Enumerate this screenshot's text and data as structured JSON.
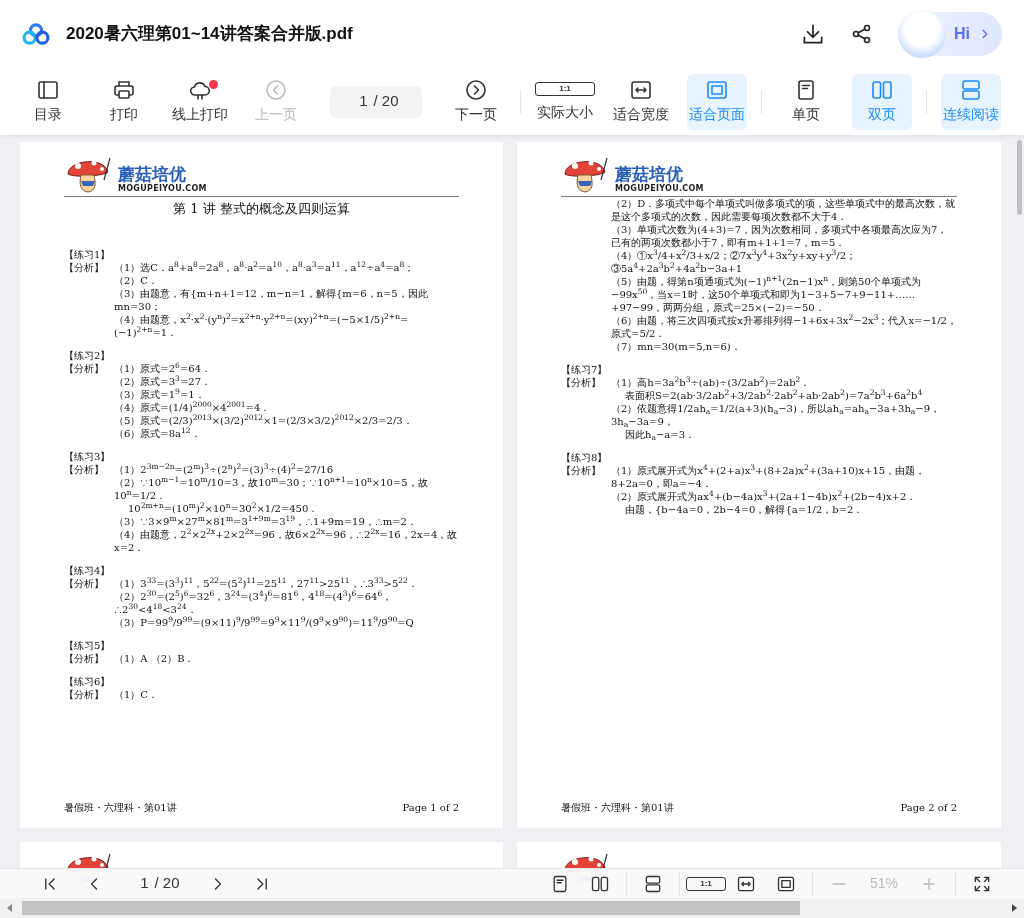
{
  "header": {
    "title": "2020暑六理第01~14讲答案合并版.pdf",
    "greeting": "Hi"
  },
  "toolbar": {
    "items": [
      {
        "kind": "toc",
        "label": "目录",
        "selected": false,
        "disabled": false,
        "notify": false,
        "divider_after": false
      },
      {
        "kind": "print",
        "label": "打印",
        "selected": false,
        "disabled": false,
        "notify": false,
        "divider_after": false
      },
      {
        "kind": "cloud",
        "label": "线上打印",
        "selected": false,
        "disabled": false,
        "notify": true,
        "divider_after": false
      },
      {
        "kind": "prev",
        "label": "上一页",
        "selected": false,
        "disabled": true,
        "notify": false,
        "divider_after": false
      },
      {
        "kind": "pagefield",
        "value": "1",
        "total": "/ 20"
      },
      {
        "kind": "next",
        "label": "下一页",
        "selected": false,
        "disabled": false,
        "notify": false,
        "divider_after": true
      },
      {
        "kind": "actual",
        "label": "实际大小",
        "icon_text": "1:1",
        "selected": false,
        "disabled": false,
        "notify": false,
        "divider_after": false
      },
      {
        "kind": "fitwidth",
        "label": "适合宽度",
        "selected": false,
        "disabled": false,
        "notify": false,
        "divider_after": false
      },
      {
        "kind": "fitpage",
        "label": "适合页面",
        "selected": true,
        "disabled": false,
        "notify": false,
        "divider_after": true
      },
      {
        "kind": "single",
        "label": "单页",
        "selected": false,
        "disabled": false,
        "notify": false,
        "divider_after": false
      },
      {
        "kind": "double",
        "label": "双页",
        "selected": true,
        "disabled": false,
        "notify": false,
        "divider_after": true
      },
      {
        "kind": "continuous",
        "label": "连续阅读",
        "selected": true,
        "disabled": false,
        "notify": false,
        "divider_after": false
      }
    ]
  },
  "pages": [
    {
      "logo_text": "蘑菇培优",
      "logo_sub": "MOGUPEIYOU.COM",
      "title": "第 1 讲  整式的概念及四则运算",
      "blocks": [
        {
          "heading": "【练习1】",
          "label": "【分析】",
          "lines": [
            {
              "kind": "item",
              "text": "（1）选C．a$^{8}$+a$^{8}$=2a$^{8}$，a$^{8}$·a$^{2}$=a$^{10}$，a$^{8}$·a$^{3}$=a$^{11}$，a$^{12}$÷a$^{4}$=a$^{8}$；"
            },
            {
              "kind": "item",
              "text": "（2）C．"
            },
            {
              "kind": "item",
              "text": "（3）由题意，有{m+n+1=12，m−n=1，解得{m=6，n=5，因此mn=30；"
            },
            {
              "kind": "item",
              "text": "（4）由题意，x$^{2}$·x$^{2}$·(y$^{n}$)$^{2}$=x$^{2+n}$·y$^{2+n}$=(xy)$^{2+n}$=(−5×1/5)$^{2+n}$=(−1)$^{2+n}$=1．"
            }
          ]
        },
        {
          "heading": "【练习2】",
          "label": "【分析】",
          "lines": [
            {
              "kind": "item",
              "text": "（1）原式=2$^{6}$=64．"
            },
            {
              "kind": "item",
              "text": "（2）原式=3$^{3}$=27．"
            },
            {
              "kind": "item",
              "text": "（3）原式=1$^{9}$=1．"
            },
            {
              "kind": "item",
              "text": "（4）原式=(1/4)$^{2000}$×4$^{2001}$=4．"
            },
            {
              "kind": "item",
              "text": "（5）原式=(2/3)$^{2013}$×(3/2)$^{2012}$×1=(2/3×3/2)$^{2012}$×2/3=2/3．"
            },
            {
              "kind": "item",
              "text": "（6）原式=8a$^{12}$．"
            }
          ]
        },
        {
          "heading": "【练习3】",
          "label": "【分析】",
          "lines": [
            {
              "kind": "item",
              "text": "（1）2$^{3m−2n}$=(2$^{m}$)$^{3}$÷(2$^{n}$)$^{2}$=(3)$^{3}$÷(4)$^{2}$=27/16"
            },
            {
              "kind": "item",
              "text": "（2）∵10$^{m−1}$=10$^{m}$/10=3，故10$^{m}$=30；∵10$^{n+1}$=10$^{n}$×10=5，故10$^{n}$=1/2．"
            },
            {
              "kind": "continuation",
              "text": "10$^{2m+n}$=(10$^{m}$)$^{2}$×10$^{n}$=30$^{2}$×1/2=450．"
            },
            {
              "kind": "item",
              "text": "（3）∵3×9$^{m}$×27$^{m}$×81$^{m}$=3$^{1+9m}$=3$^{19}$，∴1+9m=19，∴m=2．"
            },
            {
              "kind": "item",
              "text": "（4）由题意，2$^{2}$×2$^{2x}$+2×2$^{2x}$=96，故6×2$^{2x}$=96，∴2$^{2x}$=16，2x=4，故x=2．"
            }
          ]
        },
        {
          "heading": "【练习4】",
          "label": "【分析】",
          "lines": [
            {
              "kind": "item",
              "text": "（1）3$^{33}$=(3$^{3}$)$^{11}$，5$^{22}$=(5$^{2}$)$^{11}$=25$^{11}$，27$^{11}$>25$^{11}$，∴3$^{33}$>5$^{22}$．"
            },
            {
              "kind": "item",
              "text": "（2）2$^{30}$=(2$^{5}$)$^{6}$=32$^{6}$，3$^{24}$=(3$^{4}$)$^{6}$=81$^{6}$，4$^{18}$=(4$^{3}$)$^{6}$=64$^{6}$，∴2$^{30}$<4$^{18}$<3$^{24}$．"
            },
            {
              "kind": "item",
              "text": "（3）P=99$^{9}$/9$^{99}$=(9×11)$^{9}$/9$^{99}$=9$^{9}$×11$^{9}$/(9$^{9}$×9$^{90}$)=11$^{9}$/9$^{90}$=Q"
            }
          ]
        },
        {
          "heading": "【练习5】",
          "label": "【分析】",
          "lines": [
            {
              "kind": "item",
              "text": "（1）A （2）B．"
            }
          ]
        },
        {
          "heading": "【练习6】",
          "label": "【分析】",
          "lines": [
            {
              "kind": "item",
              "text": "（1）C．"
            }
          ]
        }
      ],
      "footer_left": "暑假班・六理科・第01讲",
      "footer_right": "Page 1 of 2"
    },
    {
      "logo_text": "蘑菇培优",
      "logo_sub": "MOGUPEIYOU.COM",
      "blocks": [
        {
          "lines": [
            {
              "kind": "item",
              "text": "（2）D．多项式中每个单项式叫做多项式的项，这些单项式中的最高次数，就是这个多项式的次数，因此需要每项次数都不大于4．"
            },
            {
              "kind": "item",
              "text": "（3）单项式次数为(4+3)=7，因为次数相同，多项式中各项最高次应为7，已有的两项次数都小于7，即有m+1+1=7，m=5．"
            },
            {
              "kind": "item",
              "text": "（4）①x$^{3}$/4+x$^{2}$/3+x/2；②7x$^{3}$y$^{4}$+3x$^{2}$y+xy+y$^{3}$/2；③5a$^{4}$+2a$^{3}$b$^{2}$+4a$^{2}$b−3a+1"
            },
            {
              "kind": "item",
              "text": "（5）由题，得第n项通项式为(−1)$^{n+1}$(2n−1)x$^{n}$，则第50个单项式为−99x$^{50}$，当x=1时，这50个单项式和即为1−3+5−7+9−11+……+97−99，两两分组，原式=25×(−2)=−50．"
            },
            {
              "kind": "item",
              "text": "（6）由题，将三次四项式按x升幂排列得−1+6x+3x$^{2}$−2x$^{3}$；代入x=−1/2，原式=5/2．"
            },
            {
              "kind": "item",
              "text": "（7）mn=30(m=5,n=6)．"
            }
          ]
        },
        {
          "heading": "【练习7】",
          "label": "【分析】",
          "lines": [
            {
              "kind": "item",
              "text": "（1）高h=3a$^{2}$b$^{3}$÷(ab)÷(3/2ab$^{2}$)=2ab$^{2}$．"
            },
            {
              "kind": "continuation",
              "text": "表面积S=2(ab·3/2ab$^{2}$+3/2ab$^{2}$·2ab$^{2}$+ab·2ab$^{2}$)=7a$^{2}$b$^{3}$+6a$^{2}$b$^{4}$"
            },
            {
              "kind": "item",
              "text": "（2）依题意得1/2ah$_{a}$=1/2(a+3)(h$_{a}$−3)，所以ah$_{a}$=ah$_{a}$−3a+3h$_{a}$−9，3h$_{a}$−3a=9，"
            },
            {
              "kind": "continuation",
              "text": "因此h$_{a}$−a=3．"
            }
          ]
        },
        {
          "heading": "【练习8】",
          "label": "【分析】",
          "lines": [
            {
              "kind": "item",
              "text": "（1）原式展开式为x$^{4}$+(2+a)x$^{3}$+(8+2a)x$^{2}$+(3a+10)x+15，由题，8+2a=0，即a=−4．"
            },
            {
              "kind": "item",
              "text": "（2）原式展开式为ax$^{4}$+(b−4a)x$^{3}$+(2a+1−4b)x$^{2}$+(2b−4)x+2．"
            },
            {
              "kind": "continuation",
              "text": "由题，{b−4a=0，2b−4=0，解得{a=1/2，b=2．"
            }
          ]
        }
      ],
      "footer_left": "暑假班・六理科・第01讲",
      "footer_right": "Page 2 of 2"
    }
  ],
  "bottom_bar": {
    "nav": [
      {
        "kind": "first"
      },
      {
        "kind": "prev"
      },
      {
        "kind": "pagefield",
        "value": "1",
        "total": "/ 20"
      },
      {
        "kind": "next"
      },
      {
        "kind": "last"
      }
    ],
    "views": [
      {
        "kind": "single",
        "disabled": false,
        "divider_after": false
      },
      {
        "kind": "double",
        "disabled": false,
        "divider_after": true
      },
      {
        "kind": "continuous",
        "disabled": false,
        "divider_after": true
      },
      {
        "kind": "actual",
        "icon_text": "1:1",
        "disabled": false,
        "divider_after": false
      },
      {
        "kind": "fitwidth",
        "disabled": false,
        "divider_after": false
      },
      {
        "kind": "fitpage",
        "disabled": false,
        "divider_after": true
      },
      {
        "kind": "minus",
        "disabled": true,
        "divider_after": false
      },
      {
        "kind": "zoom",
        "value": "51%",
        "disabled": true,
        "divider_after": false
      },
      {
        "kind": "plus",
        "disabled": true,
        "divider_after": true
      },
      {
        "kind": "fullscreen",
        "disabled": false,
        "divider_after": false
      }
    ]
  }
}
